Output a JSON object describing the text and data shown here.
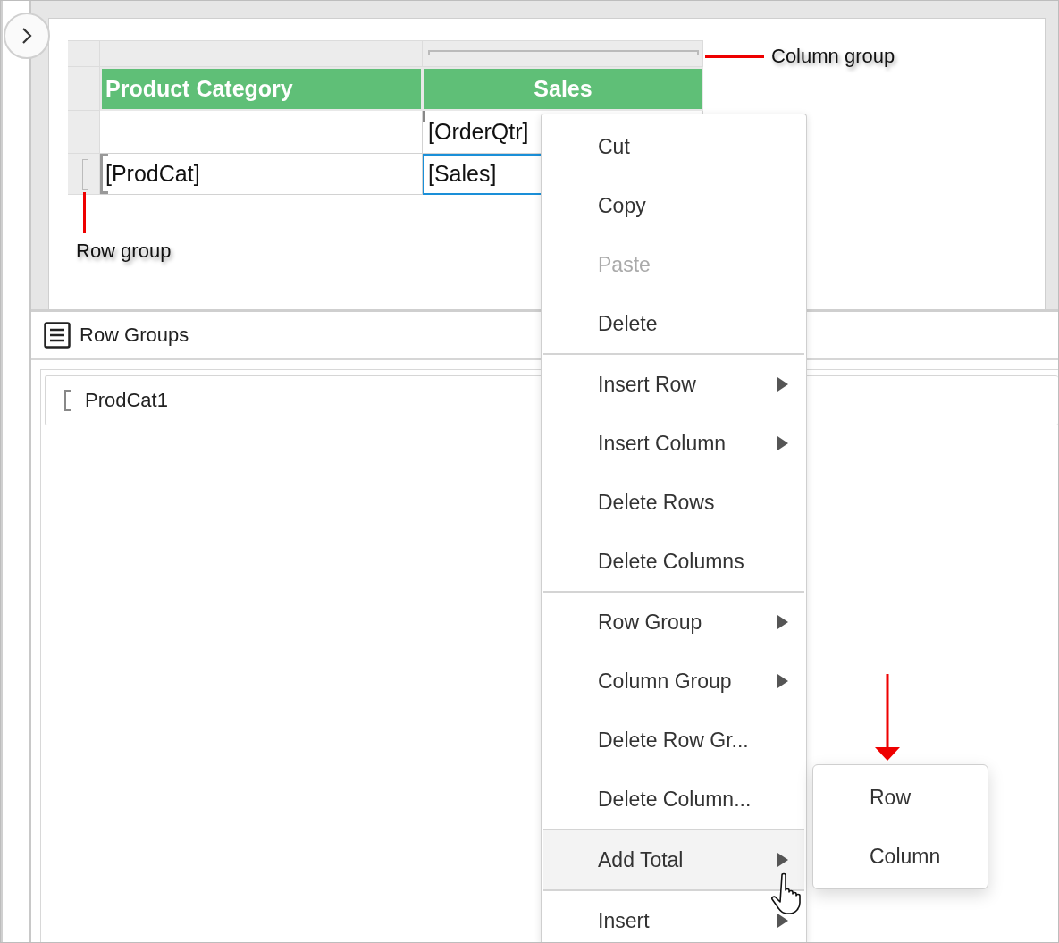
{
  "report_table": {
    "header": [
      {
        "text": "Product Category"
      },
      {
        "text": "Sales"
      }
    ],
    "rows": [
      {
        "cells": [
          {
            "selected": false
          },
          {
            "text": "[OrderQtr]",
            "selected": false
          }
        ]
      },
      {
        "cells": [
          {
            "text": "[ProdCat]",
            "selected": false
          },
          {
            "text": "[Sales]",
            "selected": true
          }
        ]
      }
    ]
  },
  "annotations": {
    "column_group": "Column group",
    "row_group": "Row group"
  },
  "row_groups_panel": {
    "title": "Row Groups",
    "items": [
      {
        "label": "ProdCat1"
      }
    ]
  },
  "context_menu": {
    "groups": [
      [
        {
          "label": "Cut",
          "disabled": false,
          "submenu": false,
          "highlighted": false
        },
        {
          "label": "Copy",
          "disabled": false,
          "submenu": false,
          "highlighted": false
        },
        {
          "label": "Paste",
          "disabled": true,
          "submenu": false,
          "highlighted": false
        },
        {
          "label": "Delete",
          "disabled": false,
          "submenu": false,
          "highlighted": false
        }
      ],
      [
        {
          "label": "Insert Row",
          "disabled": false,
          "submenu": true,
          "highlighted": false
        },
        {
          "label": "Insert Column",
          "disabled": false,
          "submenu": true,
          "highlighted": false
        },
        {
          "label": "Delete Rows",
          "disabled": false,
          "submenu": false,
          "highlighted": false
        },
        {
          "label": "Delete Columns",
          "disabled": false,
          "submenu": false,
          "highlighted": false
        }
      ],
      [
        {
          "label": "Row Group",
          "disabled": false,
          "submenu": true,
          "highlighted": false
        },
        {
          "label": "Column Group",
          "disabled": false,
          "submenu": true,
          "highlighted": false
        },
        {
          "label": "Delete Row Gr...",
          "disabled": false,
          "submenu": false,
          "highlighted": false
        },
        {
          "label": "Delete Column...",
          "disabled": false,
          "submenu": false,
          "highlighted": false
        }
      ],
      [
        {
          "label": "Add Total",
          "disabled": false,
          "submenu": true,
          "highlighted": true
        }
      ],
      [
        {
          "label": "Insert",
          "disabled": false,
          "submenu": true,
          "highlighted": false
        }
      ]
    ]
  },
  "submenu": {
    "items": [
      {
        "label": "Row"
      },
      {
        "label": "Column"
      }
    ]
  }
}
